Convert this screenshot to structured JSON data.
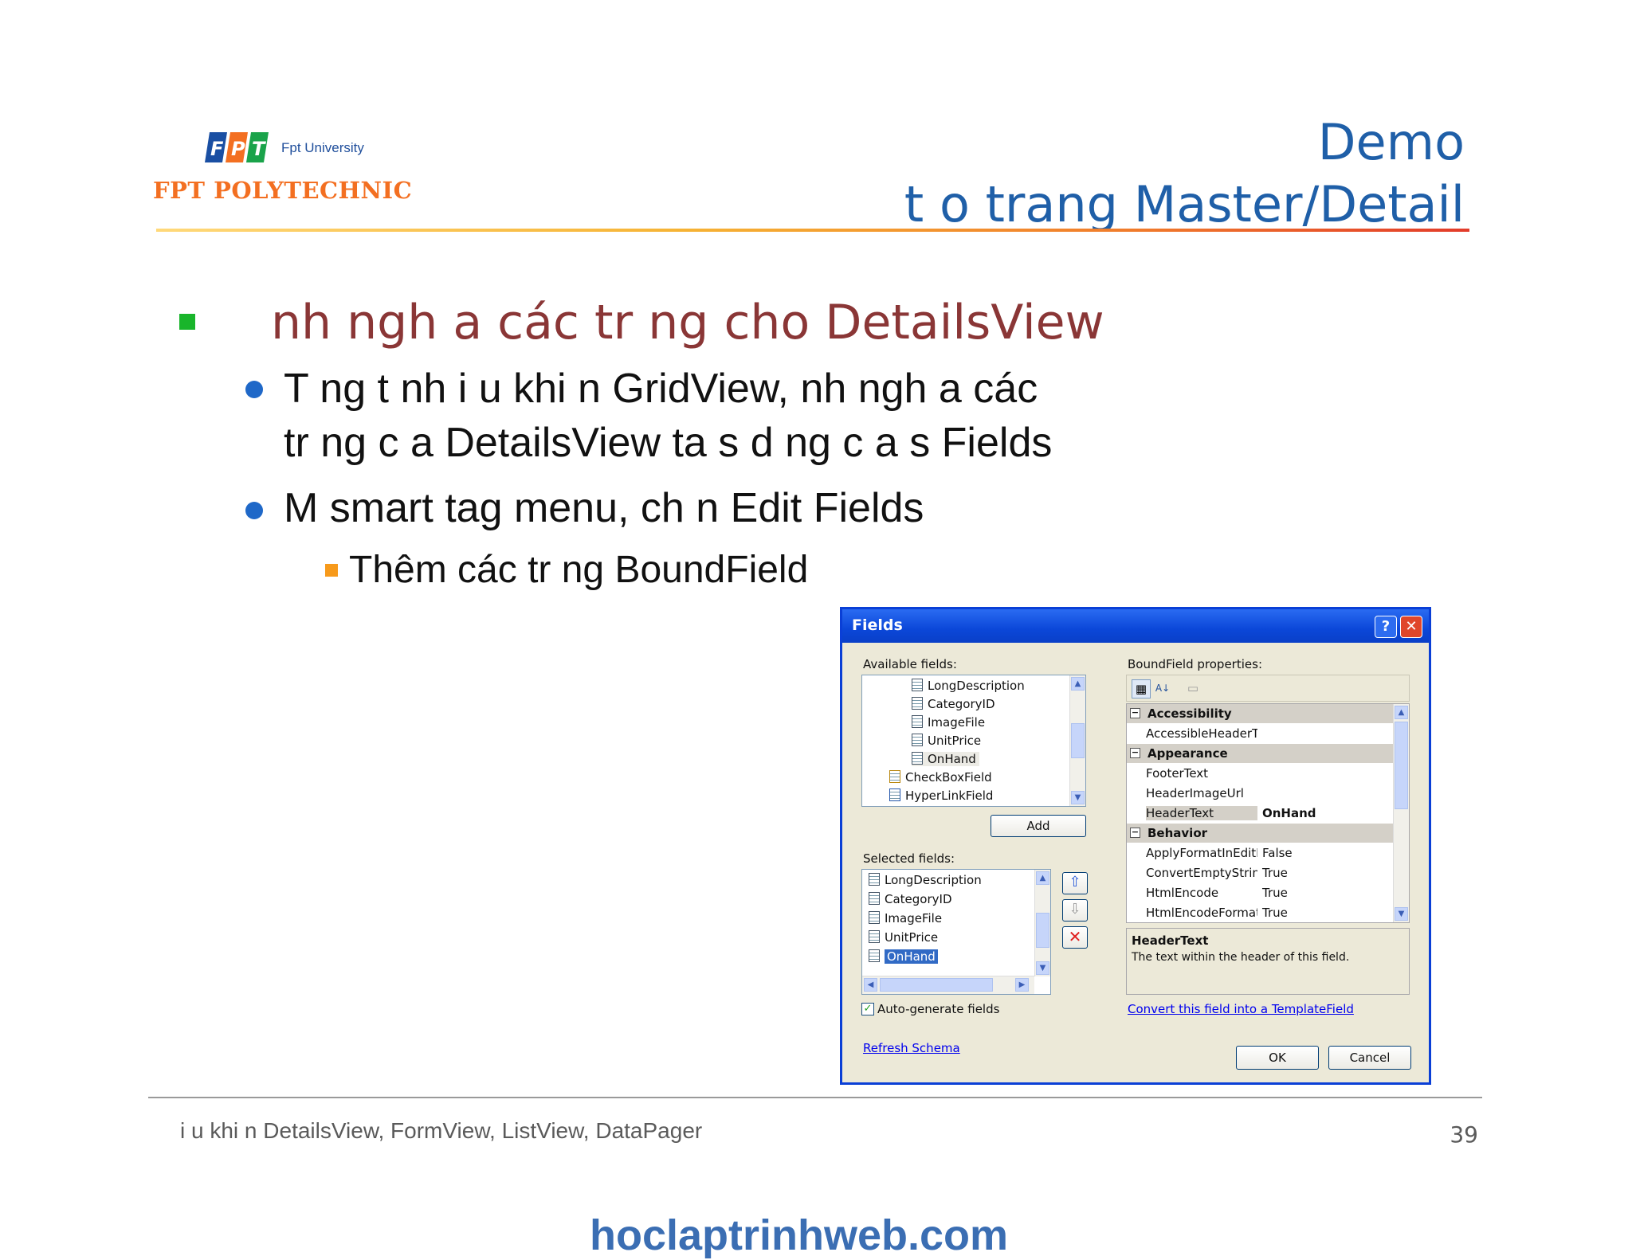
{
  "logo": {
    "mark": "FPT",
    "university": "Fpt University",
    "polytechnic": "FPT POLYTECHNIC"
  },
  "title": {
    "line1": "Demo",
    "line2": "t o trang Master/Detail"
  },
  "bullets": {
    "level1": "nh ngh a các tr     ng cho DetailsView",
    "item1_line1": "T    ng t    nh      i  u khi  n GridView,          nh ngh a các",
    "item1_line2": "tr    ng c  a DetailsView ta s    d  ng c  a s    Fields",
    "item2": "M   smart tag menu, ch  n Edit Fields",
    "sub": "Thêm các tr     ng BoundField"
  },
  "dialog": {
    "title": "Fields",
    "available_label": "Available fields:",
    "available_items": [
      "LongDescription",
      "CategoryID",
      "ImageFile",
      "UnitPrice",
      "OnHand",
      "CheckBoxField",
      "HyperLinkField"
    ],
    "add_button": "Add",
    "selected_label": "Selected fields:",
    "selected_items": [
      "LongDescription",
      "CategoryID",
      "ImageFile",
      "UnitPrice",
      "OnHand"
    ],
    "auto_generate": "Auto-generate fields",
    "refresh_link": "Refresh Schema",
    "properties_label": "BoundField properties:",
    "properties": [
      {
        "category": "Accessibility"
      },
      {
        "name": "AccessibleHeaderTe",
        "value": ""
      },
      {
        "category": "Appearance"
      },
      {
        "name": "FooterText",
        "value": ""
      },
      {
        "name": "HeaderImageUrl",
        "value": ""
      },
      {
        "name": "HeaderText",
        "value": "OnHand"
      },
      {
        "category": "Behavior"
      },
      {
        "name": "ApplyFormatInEditM",
        "value": "False"
      },
      {
        "name": "ConvertEmptyString",
        "value": "True"
      },
      {
        "name": "HtmlEncode",
        "value": "True"
      },
      {
        "name": "HtmlEncodeFormatS",
        "value": "True"
      }
    ],
    "desc_title": "HeaderText",
    "desc_text": "The text within the header of this field.",
    "convert_link": "Convert this field into a TemplateField",
    "ok": "OK",
    "cancel": "Cancel"
  },
  "footer": {
    "text": "i  u khi  n DetailsView, FormView, ListView, DataPager",
    "page": "39"
  },
  "watermark": "hoclaptrinhweb.com",
  "colors": {
    "title": "#1f5fa8",
    "level1": "#8a3636",
    "accent_green": "#19b52b",
    "accent_orange": "#f79a1b",
    "dialog_border": "#0a3fd6"
  }
}
